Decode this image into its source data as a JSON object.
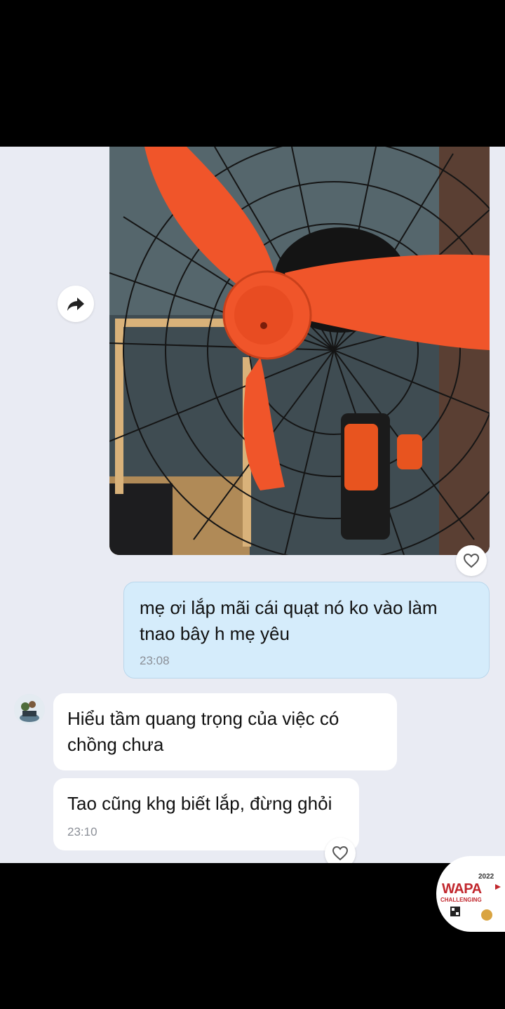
{
  "conversation": {
    "outgoing": {
      "text_line1": "mẹ ơi lắp mãi cái quạt nó ko vào làm",
      "text_line2": "tnao bây h mẹ yêu",
      "time": "23:08"
    },
    "incoming_1": {
      "text_line1": "Hiểu tầm quang trọng của việc có",
      "text_line2": "chồng chưa"
    },
    "incoming_2": {
      "text": "Tao cũng khg biết lắp, đừng ghỏi",
      "time": "23:10"
    }
  },
  "photo": {
    "blade_color": "#f0552a",
    "wall_color": "#3d4a4f"
  },
  "colors": {
    "outgoing_bubble": "#d5ecfb",
    "incoming_bubble": "#ffffff",
    "chat_bg": "#e9ebf3"
  },
  "watermark": {
    "year": "2022",
    "brand": "WAPA",
    "tagline": "CHALLENGING"
  },
  "icons": [
    "forward-icon",
    "heart-outline-icon",
    "avatar-image"
  ]
}
